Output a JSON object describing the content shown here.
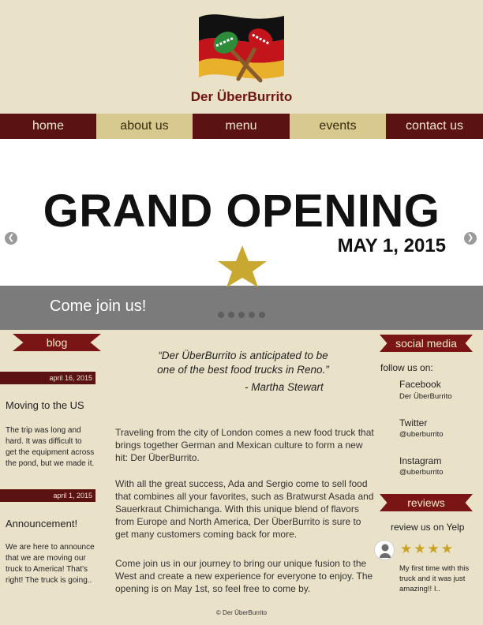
{
  "brand": {
    "name": "Der ÜberBurrito"
  },
  "nav": {
    "items": [
      {
        "label": "home"
      },
      {
        "label": "about us"
      },
      {
        "label": "menu"
      },
      {
        "label": "events"
      },
      {
        "label": "contact us"
      }
    ]
  },
  "hero": {
    "title": "GRAND OPENING",
    "date": "MAY 1, 2015",
    "banner_text": "Come join us!",
    "slide_count": 5
  },
  "blog": {
    "heading": "blog",
    "posts": [
      {
        "date": "april 16, 2015",
        "title": "Moving to the US",
        "body": "The trip was long and hard. It was difficult to get the equipment across the pond, but we made it."
      },
      {
        "date": "april 1, 2015",
        "title": "Announcement!",
        "body": "We are here to announce that we are moving our truck to America! That's right! The truck is going.."
      }
    ]
  },
  "main": {
    "quote": "“Der ÜberBurrito is anticipated to be one of the best food trucks in Reno.”",
    "quote_author": "- Martha Stewart",
    "paragraphs": [
      "Traveling from the city of London comes a new food truck that brings together German and Mexican culture to form a new hit: Der ÜberBurrito.",
      "With all the great success, Ada and Sergio come to sell food that combines all your favorites, such as Bratwurst Asada and Sauerkraut Chimichanga. With this unique blend of flavors from Europe and North America, Der ÜberBurrito is sure to get many customers coming back for more.",
      "Come join us in our journey to bring our unique fusion to the West and create a new experience for everyone to enjoy. The opening is on May 1st, so feel free to come by."
    ]
  },
  "social": {
    "heading": "social media",
    "follow_label": "follow us on:",
    "accounts": [
      {
        "name": "Facebook",
        "handle": "Der ÜberBurrito"
      },
      {
        "name": "Twitter",
        "handle": "@uberburrito"
      },
      {
        "name": "Instagram",
        "handle": "@uberburrito"
      }
    ]
  },
  "reviews": {
    "heading": "reviews",
    "yelp_label": "review us on Yelp",
    "rating": 4,
    "rating_max": 4,
    "star_glyphs": "★★★★",
    "text": "My first time with this truck and it was just amazing!! I.."
  },
  "footer": {
    "text": "© Der ÜberBurrito"
  },
  "colors": {
    "background": "#e9e1c8",
    "dark_red": "#5a1212",
    "ribbon_red": "#7a1515",
    "tan": "#d8c98f",
    "gold": "#c9a227",
    "banner_gray": "#7b7b7b"
  },
  "icons": [
    "flag-icon",
    "maracas-icon",
    "star-icon",
    "arrow-left-icon",
    "arrow-right-icon",
    "user-avatar-icon"
  ]
}
